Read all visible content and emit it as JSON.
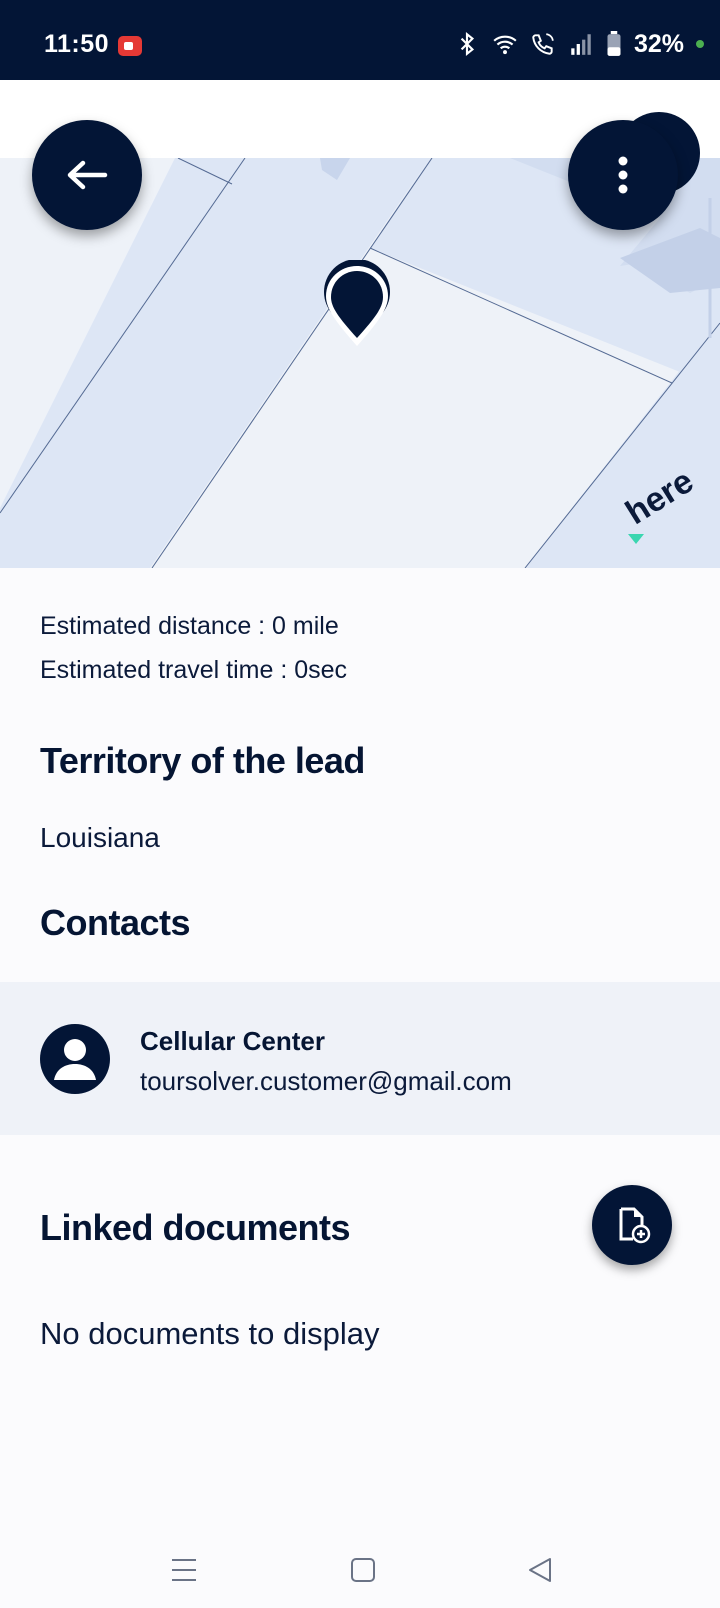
{
  "status_bar": {
    "time": "11:50",
    "battery": "32%",
    "icons": [
      "screen-record-icon",
      "bluetooth-icon",
      "wifi-icon",
      "wifi-calling-icon",
      "signal-icon",
      "battery-icon"
    ]
  },
  "header": {
    "back_icon": "arrow-left-icon",
    "menu_icon": "more-vertical-icon"
  },
  "map": {
    "provider_logo": "here",
    "marker_icon": "location-pin-icon"
  },
  "route": {
    "distance": "Estimated distance : 0 mile",
    "travel_time": "Estimated travel time : 0sec"
  },
  "territory": {
    "title": "Territory of the lead",
    "value": "Louisiana"
  },
  "contacts": {
    "title": "Contacts",
    "items": [
      {
        "name": "Cellular Center",
        "email": "toursolver.customer@gmail.com",
        "icon": "person-avatar-icon"
      }
    ]
  },
  "documents": {
    "title": "Linked documents",
    "empty_text": "No documents to display",
    "add_icon": "add-document-icon"
  },
  "nav_bar": {
    "icons": [
      "recents-icon",
      "home-icon",
      "back-icon"
    ]
  },
  "colors": {
    "primary": "#031536",
    "map_background": "#eef2f8",
    "map_road": "#dde6f5",
    "contact_row": "#eff2f8"
  }
}
